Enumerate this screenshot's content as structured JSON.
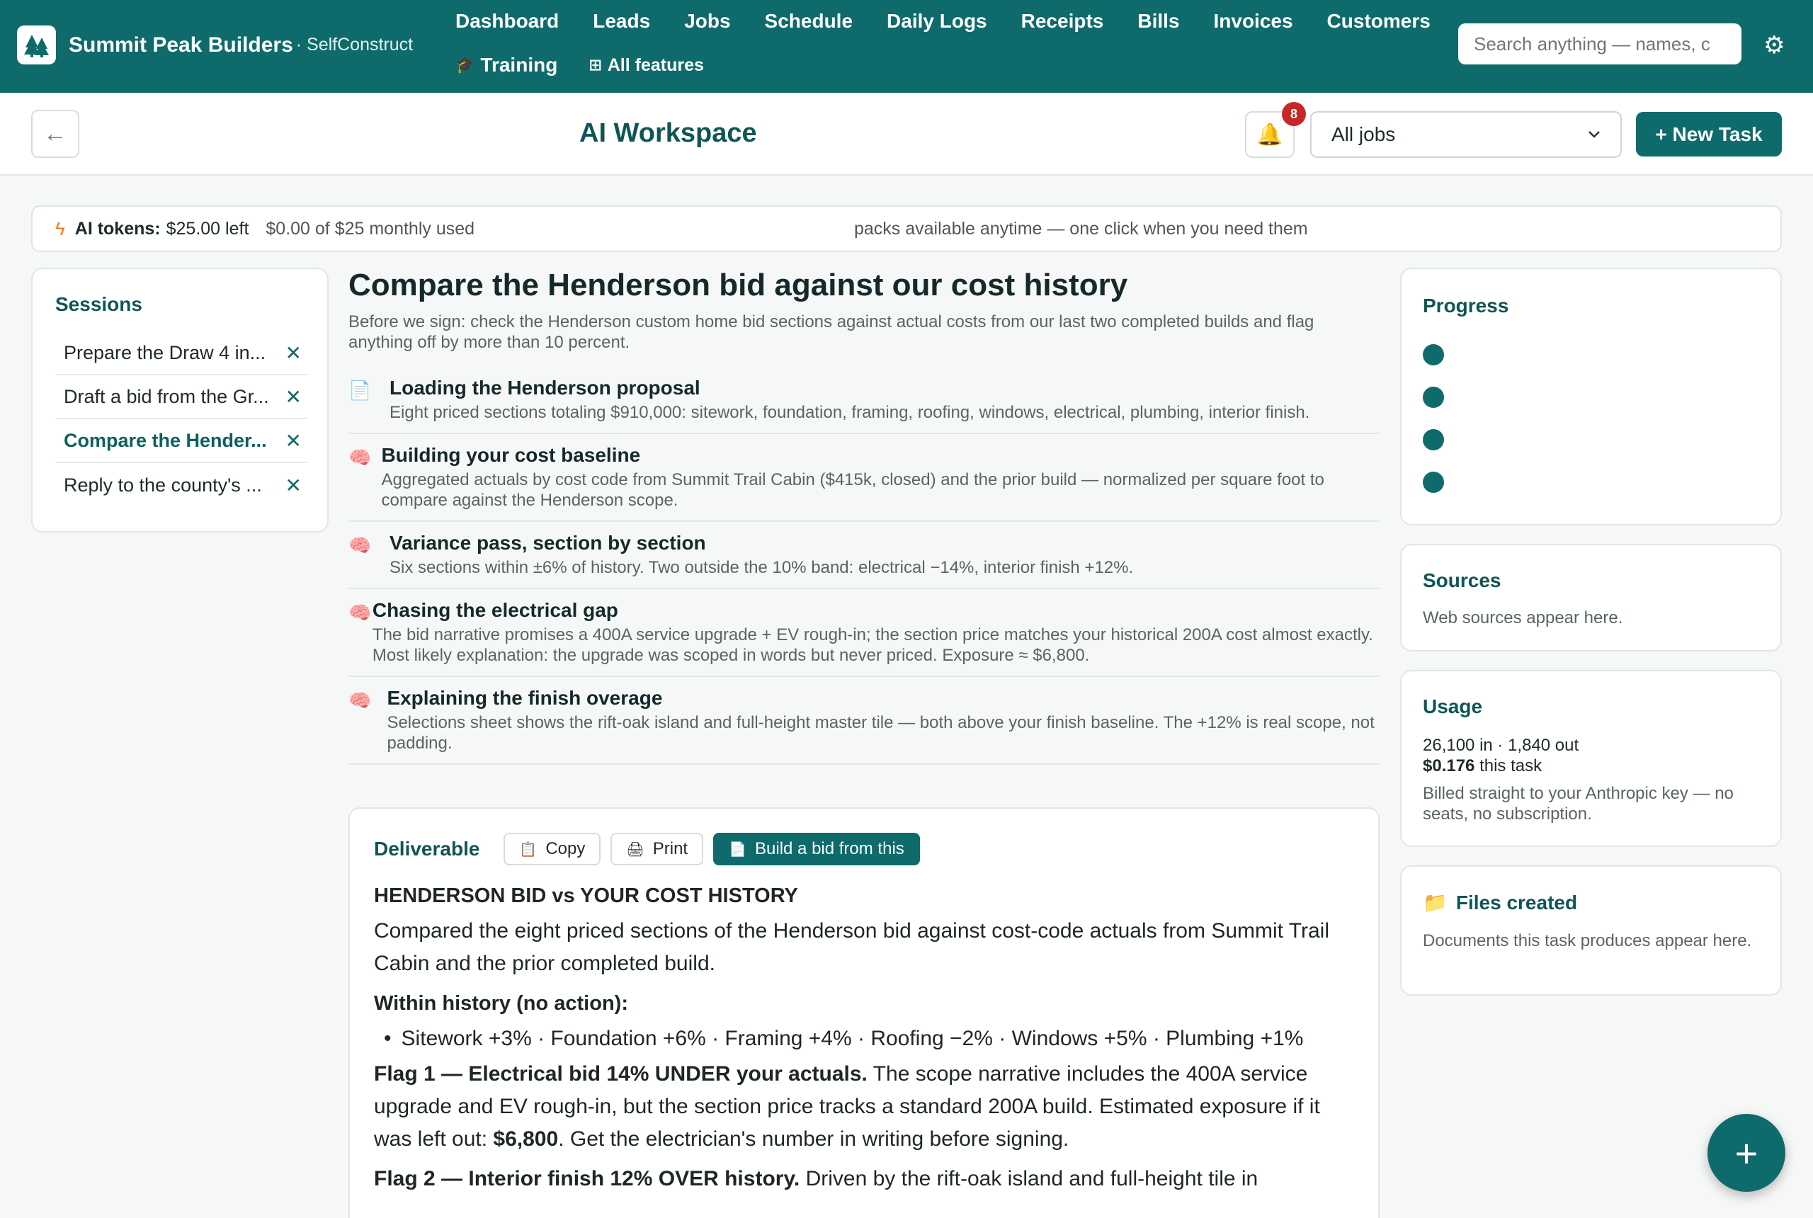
{
  "brand": {
    "name": "Summit Peak Builders",
    "sub": "· SelfConstruct"
  },
  "nav": {
    "row1": [
      "Dashboard",
      "Leads",
      "Jobs",
      "Schedule",
      "Daily Logs",
      "Receipts",
      "Bills",
      "Invoices",
      "Customers"
    ],
    "training": "Training",
    "all_features": "All features",
    "search_placeholder": "Search anything — names, c"
  },
  "header": {
    "title": "AI Workspace",
    "notifications": "8",
    "job_filter": "All jobs",
    "new_task": "+ New Task"
  },
  "tokens": {
    "label": "AI tokens:",
    "amount": "$25.00 left",
    "used": "$0.00 of $25 monthly used",
    "packs": "packs available anytime — one click when you need them"
  },
  "sessions": {
    "title": "Sessions",
    "items": [
      {
        "label": "Prepare the Draw 4 in..."
      },
      {
        "label": "Draft a bid from the Gr..."
      },
      {
        "label": "Compare the Hender..."
      },
      {
        "label": "Reply to the county's ..."
      }
    ]
  },
  "task": {
    "title": "Compare the Henderson bid against our cost history",
    "description": "Before we sign: check the Henderson custom home bid sections against actual costs from our last two completed builds and flag anything off by more than 10 percent.",
    "steps": [
      {
        "icon": "document-icon",
        "title": "Loading the Henderson proposal",
        "text": "Eight priced sections totaling $910,000: sitework, foundation, framing, roofing, windows, electrical, plumbing, interior finish."
      },
      {
        "icon": "brain-icon",
        "title": "Building your cost baseline",
        "text": "Aggregated actuals by cost code from Summit Trail Cabin ($415k, closed) and the prior build — normalized per square foot to compare against the Henderson scope."
      },
      {
        "icon": "brain-icon",
        "title": "Variance pass, section by section",
        "text": "Six sections within ±6% of history. Two outside the 10% band: electrical −14%, interior finish +12%."
      },
      {
        "icon": "brain-icon",
        "title": "Chasing the electrical gap",
        "text": "The bid narrative promises a 400A service upgrade + EV rough-in; the section price matches your historical 200A cost almost exactly. Most likely explanation: the upgrade was scoped in words but never priced. Exposure ≈ $6,800."
      },
      {
        "icon": "brain-icon",
        "title": "Explaining the finish overage",
        "text": "Selections sheet shows the rift-oak island and full-height master tile — both above your finish baseline. The +12% is real scope, not padding."
      }
    ]
  },
  "deliverable": {
    "title": "Deliverable",
    "copy": "Copy",
    "print": "Print",
    "build": "Build a bid from this",
    "heading": "HENDERSON BID vs YOUR COST HISTORY",
    "intro": "Compared the eight priced sections of the Henderson bid against cost-code actuals from Summit Trail Cabin and the prior completed build.",
    "within_heading": "Within history (no action):",
    "within_item": "Sitework +3% · Foundation +6% · Framing +4% · Roofing −2% · Windows +5% · Plumbing +1%",
    "flag1_bold": "Flag 1 — Electrical bid 14% UNDER your actuals.",
    "flag1_text": " The scope narrative includes the 400A service upgrade and EV rough-in, but the section price tracks a standard 200A build. Estimated exposure if it was left out: ",
    "flag1_amount": "$6,800",
    "flag1_end": ". Get the electrician's number in writing before signing.",
    "flag2_bold": "Flag 2 — Interior finish 12% OVER history.",
    "flag2_text": " Driven by the rift-oak island and full-height tile in"
  },
  "progress": {
    "title": "Progress",
    "steps_done": 4
  },
  "sources": {
    "title": "Sources",
    "empty": "Web sources appear here."
  },
  "usage": {
    "title": "Usage",
    "tokens": "26,100 in · 1,840 out",
    "cost": "$0.176",
    "cost_suffix": " this task",
    "note": "Billed straight to your Anthropic key — no seats, no subscription."
  },
  "files": {
    "title": "Files created",
    "empty": "Documents this task produces appear here."
  },
  "colors": {
    "brand": "#0f6b6b",
    "badge": "#c62828",
    "bolt": "#f07a1a"
  }
}
